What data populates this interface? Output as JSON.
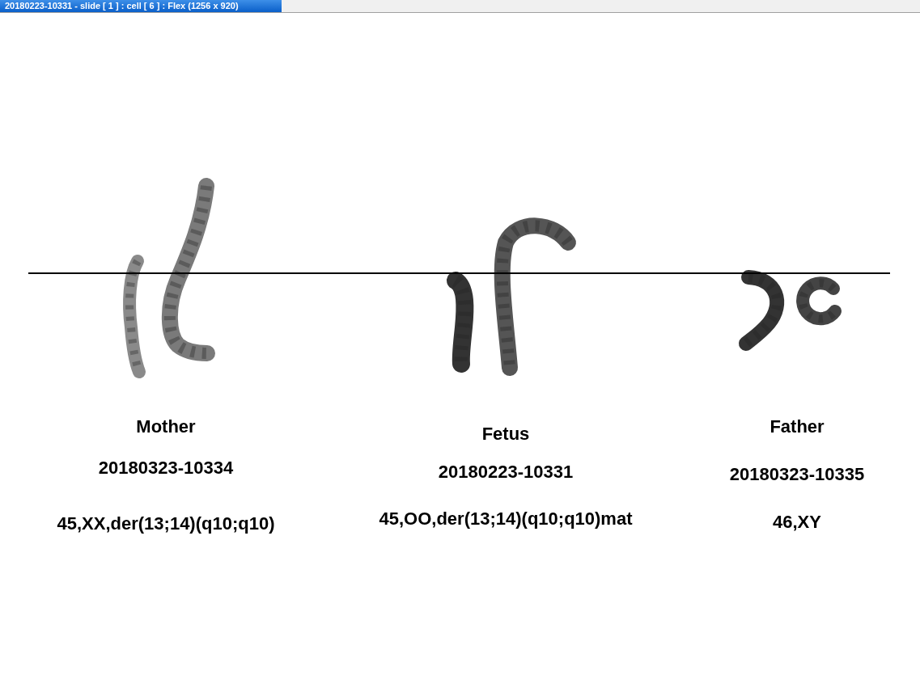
{
  "window": {
    "title": "20180223-10331 - slide [ 1 ] : cell [ 6 ] : Flex (1256 x 920)"
  },
  "panels": [
    {
      "label": "Mother",
      "id": "20180323-10334",
      "karyotype": "45,XX,der(13;14)(q10;q10)"
    },
    {
      "label": "Fetus",
      "id": "20180223-10331",
      "karyotype": "45,OO,der(13;14)(q10;q10)mat"
    },
    {
      "label": "Father",
      "id": "20180323-10335",
      "karyotype": "46,XY"
    }
  ]
}
